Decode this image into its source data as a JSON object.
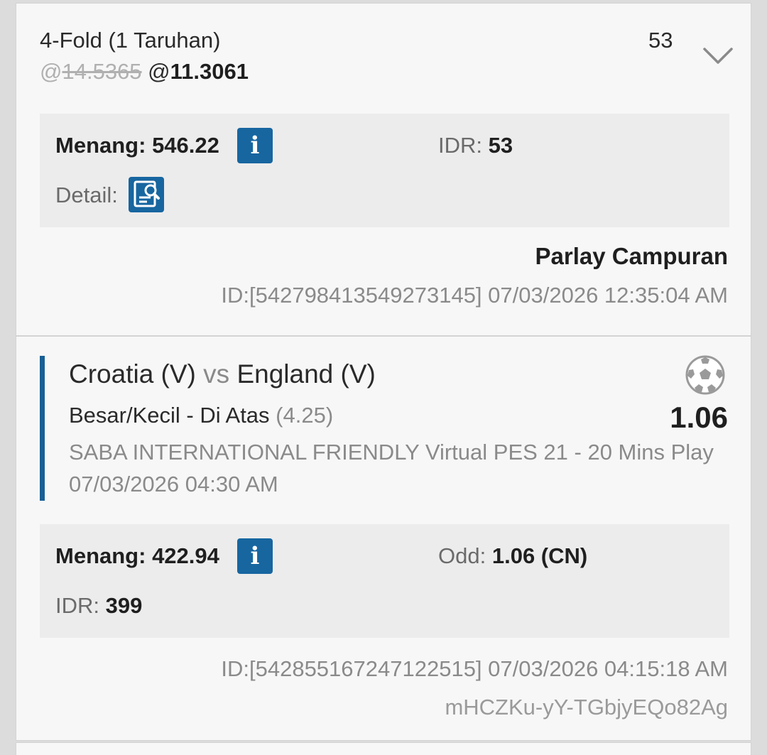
{
  "parlay": {
    "title": "4-Fold (1 Taruhan)",
    "stake": "53",
    "odds_prefix": "@",
    "odds_old": "14.5365",
    "odds_prefix_new": "@",
    "odds_new": "11.3061",
    "panel": {
      "win_label": "Menang:",
      "win_value": "546.22",
      "currency_label": "IDR:",
      "currency_value": "53",
      "detail_label": "Detail:"
    },
    "bet_type": "Parlay Campuran",
    "id_line": "ID:[542798413549273145]  07/03/2026 12:35:04 AM"
  },
  "leg": {
    "home": "Croatia (V)",
    "vs": "vs",
    "away": "England (V)",
    "market": "Besar/Kecil - Di Atas",
    "handicap": "(4.25)",
    "odds": "1.06",
    "league": "SABA INTERNATIONAL FRIENDLY Virtual PES 21 - 20 Mins Play",
    "kickoff": "07/03/2026 04:30 AM",
    "panel": {
      "win_label": "Menang:",
      "win_value": "422.94",
      "odd_label": "Odd:",
      "odd_value": "1.06 (CN)",
      "currency_label": "IDR:",
      "currency_value": "399"
    },
    "id_line": "ID:[542855167247122515]  07/03/2026 04:15:18 AM",
    "code": "mHCZKu-yY-TGbjyEQo82Ag"
  },
  "icons": {
    "info": "info-icon",
    "detail": "detail-search-icon",
    "expand": "chevron-down-icon",
    "sport": "soccer-ball-icon"
  },
  "colors": {
    "accent": "#1766a0",
    "panel_bg": "#ececec",
    "card_bg": "#f7f7f7"
  }
}
